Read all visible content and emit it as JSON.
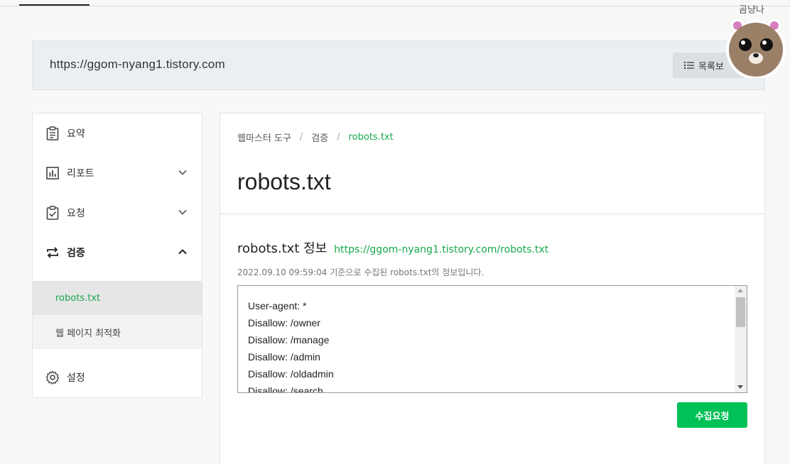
{
  "site": {
    "url": "https://ggom-nyang1.tistory.com",
    "list_button_label": "목록보"
  },
  "mascot": {
    "label": "곰냥나"
  },
  "sidebar": {
    "items": [
      {
        "label": "요약",
        "icon": "clipboard-icon"
      },
      {
        "label": "리포트",
        "icon": "chart-icon"
      },
      {
        "label": "요청",
        "icon": "checklist-icon"
      },
      {
        "label": "검증",
        "icon": "swap-arrows-icon"
      },
      {
        "label": "설정",
        "icon": "gear-icon"
      }
    ],
    "sub_items": [
      {
        "label": "robots.txt"
      },
      {
        "label": "웹 페이지 최적화"
      }
    ]
  },
  "breadcrumb": [
    "웹마스터 도구",
    "검증",
    "robots.txt"
  ],
  "page_title": "robots.txt",
  "info": {
    "title": "robots.txt 정보",
    "link": "https://ggom-nyang1.tistory.com/robots.txt",
    "description": "2022.09.10 09:59:04 기준으로 수집된 robots.txt의 정보입니다."
  },
  "robots_lines": [
    "User-agent: *",
    "Disallow: /owner",
    "Disallow: /manage",
    "Disallow: /admin",
    "Disallow: /oldadmin",
    "Disallow: /search"
  ],
  "collect_button_label": "수집요청",
  "colors": {
    "accent_green": "#00c157",
    "link_green": "#18a84d"
  }
}
